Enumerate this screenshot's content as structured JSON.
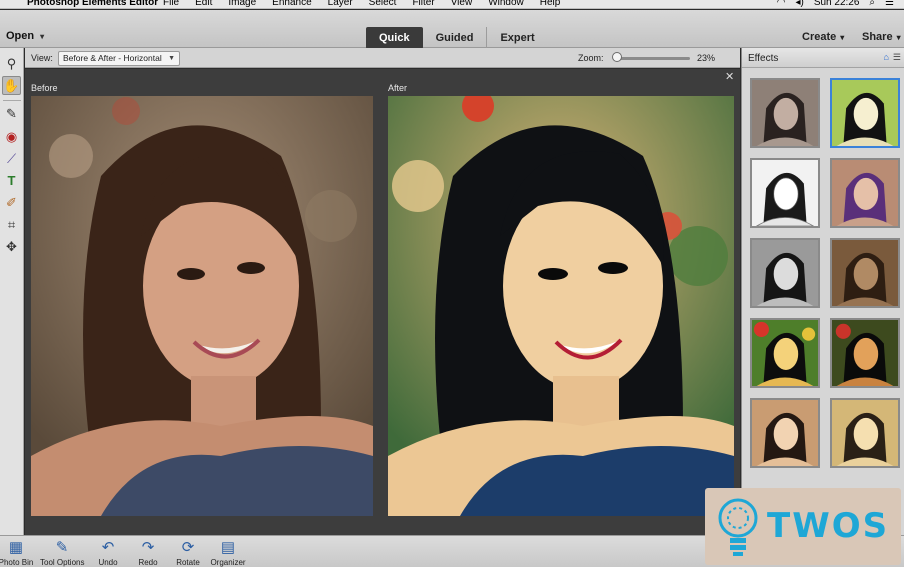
{
  "menubar": {
    "apple": "",
    "app_name": "Photoshop Elements Editor",
    "items": [
      "File",
      "Edit",
      "Image",
      "Enhance",
      "Layer",
      "Select",
      "Filter",
      "View",
      "Window",
      "Help"
    ],
    "clock": "Sun 22:26"
  },
  "appbar": {
    "open_label": "Open",
    "modes": [
      "Quick",
      "Guided",
      "Expert"
    ],
    "active_mode": "Quick",
    "create_label": "Create",
    "share_label": "Share"
  },
  "viewbar": {
    "view_label": "View:",
    "view_value": "Before & After - Horizontal",
    "zoom_label": "Zoom:",
    "zoom_value": "23%",
    "zoom_level": 0.23
  },
  "canvas": {
    "before_label": "Before",
    "after_label": "After"
  },
  "effects": {
    "title": "Effects",
    "thumbnails": [
      {
        "name": "muted-gray"
      },
      {
        "name": "pop-color"
      },
      {
        "name": "sketch-bw"
      },
      {
        "name": "purple-tint"
      },
      {
        "name": "grayscale"
      },
      {
        "name": "sepia-brown"
      },
      {
        "name": "vivid-yellow"
      },
      {
        "name": "high-contrast-warm"
      },
      {
        "name": "soft-warm"
      },
      {
        "name": "golden-fade"
      }
    ]
  },
  "bottombar": {
    "items": [
      "Photo Bin",
      "Tool Options",
      "Undo",
      "Redo",
      "Rotate",
      "Organizer"
    ]
  },
  "watermark": {
    "text": "TWOS"
  },
  "colors": {
    "accent": "#3b82d9",
    "canvas_bg": "#3d3d3d",
    "watermark_bg": "#d9c7b7",
    "watermark_text": "#1ea7d6"
  }
}
